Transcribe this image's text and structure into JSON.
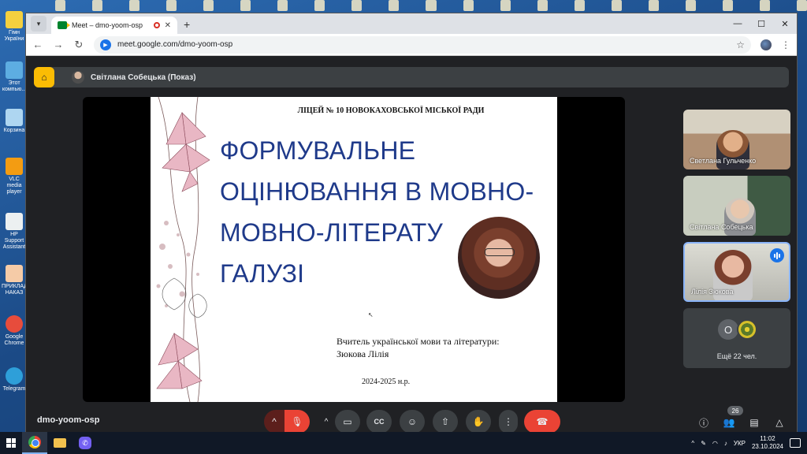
{
  "desktop": {
    "icons": [
      {
        "label": "Гімн України",
        "color": "#f4d03f"
      },
      {
        "label": "Этот компью...",
        "color": "#5dade2"
      },
      {
        "label": "Корзина",
        "color": "#aed6f1"
      },
      {
        "label": "VLC media player",
        "color": "#f39c12"
      },
      {
        "label": "HP Support Assistant",
        "color": "#ecf0f1"
      },
      {
        "label": "ПРИКЛАД НАКАЗ",
        "color": "#f5cba7"
      },
      {
        "label": "Google Chrome",
        "color": "#e74c3c"
      },
      {
        "label": "Telegram",
        "color": "#2e9fd9"
      }
    ]
  },
  "browser": {
    "tab_menu_icon": "chevron-down-icon",
    "tab_title": "Meet – dmo-yoom-osp",
    "tab_close": "✕",
    "new_tab": "+",
    "minimize": "—",
    "maximize": "☐",
    "close": "✕",
    "back": "←",
    "forward": "→",
    "reload": "↻",
    "url": "meet.google.com/dmo-yoom-osp",
    "bookmark": "☆",
    "menu": "⋮"
  },
  "meet": {
    "presenter_label": "Світлана Собецька (Показ)",
    "meeting_code": "dmo-yoom-osp",
    "slide": {
      "school": "ЛІЦЕЙ № 10 НОВОКАХОВСЬКОЇ МІСЬКОЇ РАДИ",
      "title_lines": [
        "ФОРМУВАЛЬНЕ",
        "ОЦІНЮВАННЯ В МОВНО-",
        "МОВНО-ЛІТЕРАТУ",
        "ГАЛУЗІ"
      ],
      "teacher_line1": "Вчитель української мови та літератури:",
      "teacher_line2": "Зюкова Лілія",
      "year": "2024-2025 н.р."
    },
    "participants": [
      {
        "name": "Светлана Гульченко"
      },
      {
        "name": "Світлана Собецька"
      },
      {
        "name": "Лілія Зюкова",
        "speaking": true
      }
    ],
    "more": {
      "initial": "О",
      "label": "Ещё 22 чел."
    },
    "participant_count": "26",
    "controls": {
      "caret": "^",
      "mic": "🎙",
      "camera": "▭",
      "captions": "CC",
      "emoji": "☺",
      "present": "⇧",
      "hand": "✋",
      "more": "⋮",
      "end": "☎",
      "info": "ⓘ",
      "people": "👥",
      "chat": "▤",
      "activities": "△"
    }
  },
  "taskbar": {
    "tray_arrow": "^",
    "lang": "УКР",
    "time": "11:02",
    "date": "23.10.2024"
  },
  "colors": {
    "meet_bg": "#202124",
    "end_call": "#ea4335",
    "slide_title": "#1f3a8a",
    "speaking_border": "#8ab4f8"
  }
}
